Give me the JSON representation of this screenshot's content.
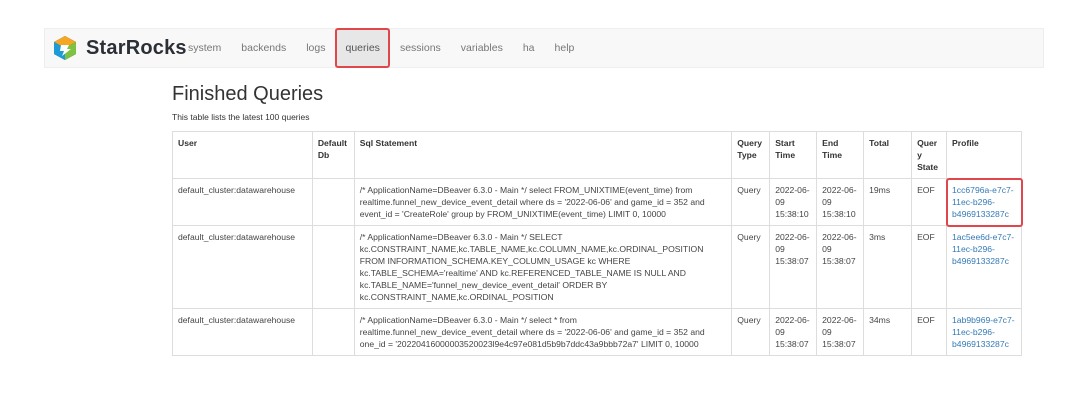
{
  "brand": {
    "name": "StarRocks"
  },
  "nav": {
    "items": [
      "system",
      "backends",
      "logs",
      "queries",
      "sessions",
      "variables",
      "ha",
      "help"
    ],
    "active": "queries"
  },
  "page": {
    "title": "Finished Queries",
    "subtitle": "This table lists the latest 100 queries"
  },
  "table": {
    "headers": [
      "User",
      "Default Db",
      "Sql Statement",
      "Query Type",
      "Start Time",
      "End Time",
      "Total",
      "Query State",
      "Profile"
    ],
    "rows": [
      {
        "user": "default_cluster:datawarehouse",
        "default_db": "",
        "sql": "/* ApplicationName=DBeaver 6.3.0 - Main */ select FROM_UNIXTIME(event_time) from realtime.funnel_new_device_event_detail where ds = '2022-06-06' and game_id = 352 and event_id = 'CreateRole' group by FROM_UNIXTIME(event_time) LIMIT 0, 10000",
        "query_type": "Query",
        "start_time": "2022-06-09 15:38:10",
        "end_time": "2022-06-09 15:38:10",
        "total": "19ms",
        "state": "EOF",
        "profile": "1cc6796a-e7c7-11ec-b296-b4969133287c"
      },
      {
        "user": "default_cluster:datawarehouse",
        "default_db": "",
        "sql": "/* ApplicationName=DBeaver 6.3.0 - Main */ SELECT kc.CONSTRAINT_NAME,kc.TABLE_NAME,kc.COLUMN_NAME,kc.ORDINAL_POSITION FROM INFORMATION_SCHEMA.KEY_COLUMN_USAGE kc WHERE kc.TABLE_SCHEMA='realtime' AND kc.REFERENCED_TABLE_NAME IS NULL AND kc.TABLE_NAME='funnel_new_device_event_detail' ORDER BY kc.CONSTRAINT_NAME,kc.ORDINAL_POSITION",
        "query_type": "Query",
        "start_time": "2022-06-09 15:38:07",
        "end_time": "2022-06-09 15:38:07",
        "total": "3ms",
        "state": "EOF",
        "profile": "1ac5ee6d-e7c7-11ec-b296-b4969133287c"
      },
      {
        "user": "default_cluster:datawarehouse",
        "default_db": "",
        "sql": "/* ApplicationName=DBeaver 6.3.0 - Main */ select * from realtime.funnel_new_device_event_detail where ds = '2022-06-06' and game_id = 352 and one_id = '20220416000003520023l9e4c97e081d5b9b7ddc43a9bbb72a7' LIMIT 0, 10000",
        "query_type": "Query",
        "start_time": "2022-06-09 15:38:07",
        "end_time": "2022-06-09 15:38:07",
        "total": "34ms",
        "state": "EOF",
        "profile": "1ab9b969-e7c7-11ec-b296-b4969133287c"
      }
    ]
  },
  "annotations": {
    "highlight_color": "#e0474c"
  },
  "colors": {
    "link": "#337ab7",
    "nav_bg": "#f8f8f8",
    "nav_active_bg": "#e7e7e7"
  }
}
